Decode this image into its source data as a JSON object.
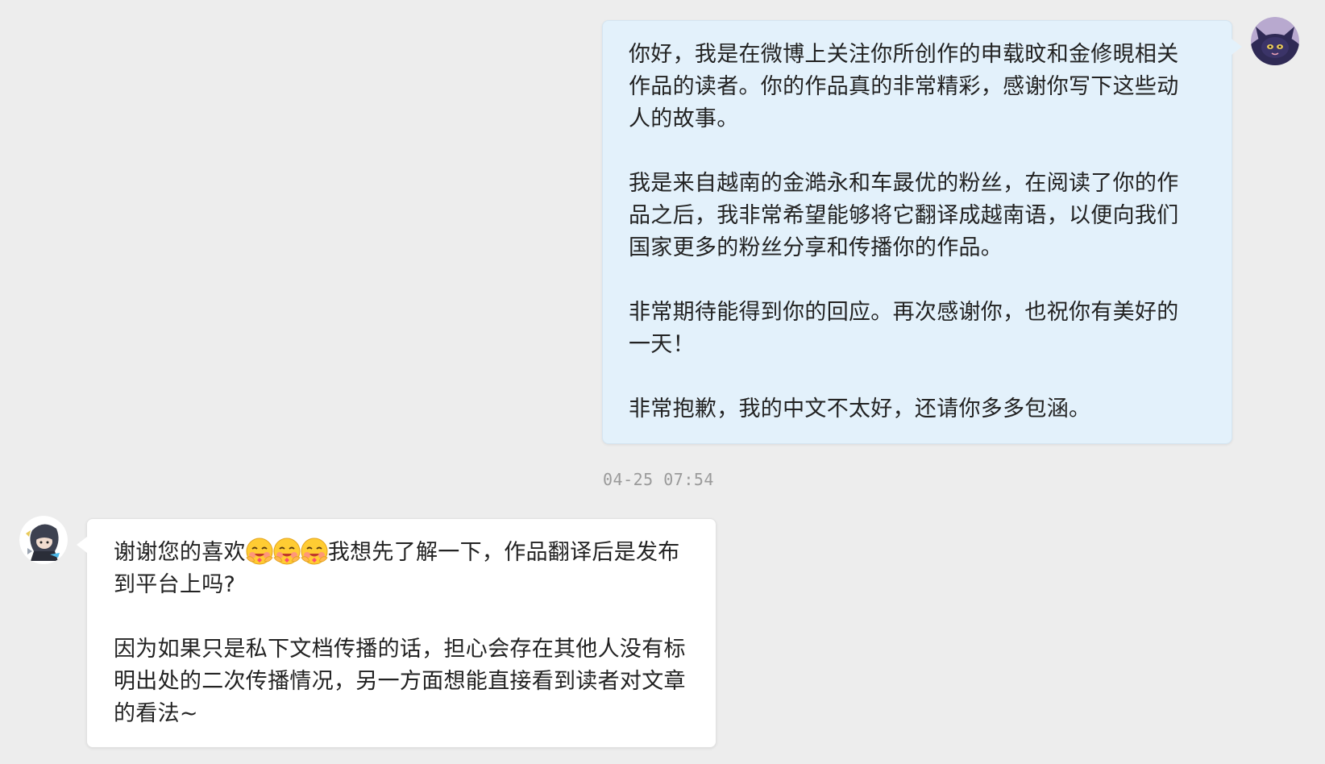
{
  "outgoing": {
    "paragraphs": [
      "你好，我是在微博上关注你所创作的申载旼和金修晛相关作品的读者。你的作品真的非常精彩，感谢你写下这些动人的故事。",
      "我是来自越南的金澔永和车晸优的粉丝，在阅读了你的作品之后，我非常希望能够将它翻译成越南语，以便向我们国家更多的粉丝分享和传播你的作品。",
      "非常期待能得到你的回应。再次感谢你，也祝你有美好的一天！",
      "非常抱歉，我的中文不太好，还请你多多包涵。"
    ]
  },
  "timestamp": "04-25 07:54",
  "incoming": {
    "text_before_emoji": "谢谢您的喜欢",
    "emoji_icon": "hugging-face-emoji-icon",
    "emoji_count": 3,
    "text_after_emoji": "我想先了解一下，作品翻译后是发布到平台上吗?",
    "paragraph_2": "因为如果只是私下文档传播的话，担心会存在其他人没有标明出处的二次传播情况，另一方面想能直接看到读者对文章的看法~"
  },
  "colors": {
    "background": "#ededed",
    "outgoing_bubble": "#e3f1fb",
    "incoming_bubble": "#ffffff",
    "timestamp_text": "#9a9a9a"
  }
}
